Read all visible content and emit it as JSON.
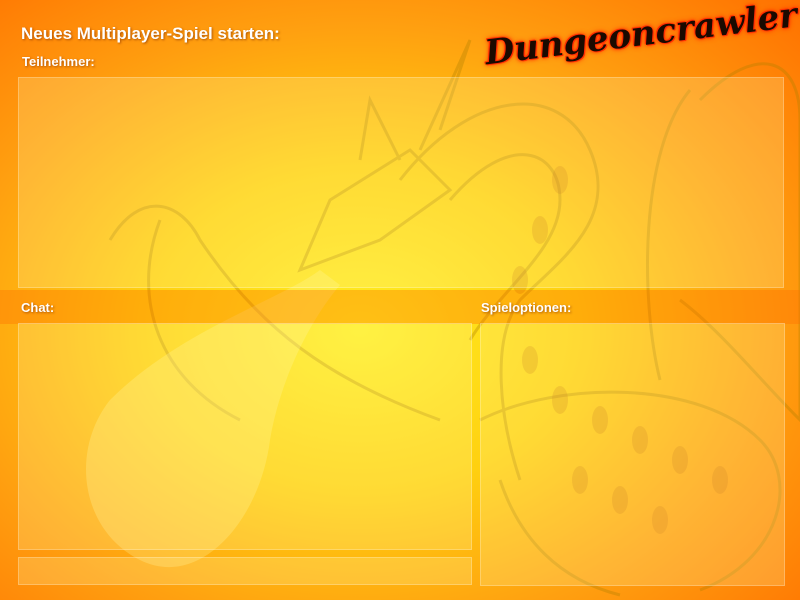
{
  "screen": {
    "title": "Neues Multiplayer-Spiel starten:",
    "logo_text": "Dungeoncrawler"
  },
  "participants": {
    "label": "Teilnehmer:",
    "entries": []
  },
  "chat": {
    "label": "Chat:",
    "messages": [],
    "input_value": ""
  },
  "game_options": {
    "label": "Spieloptionen:",
    "options": []
  },
  "colors": {
    "background_center": "#ffee22",
    "background_edge": "#ff7000",
    "logo_glow": "#ff2a00"
  }
}
